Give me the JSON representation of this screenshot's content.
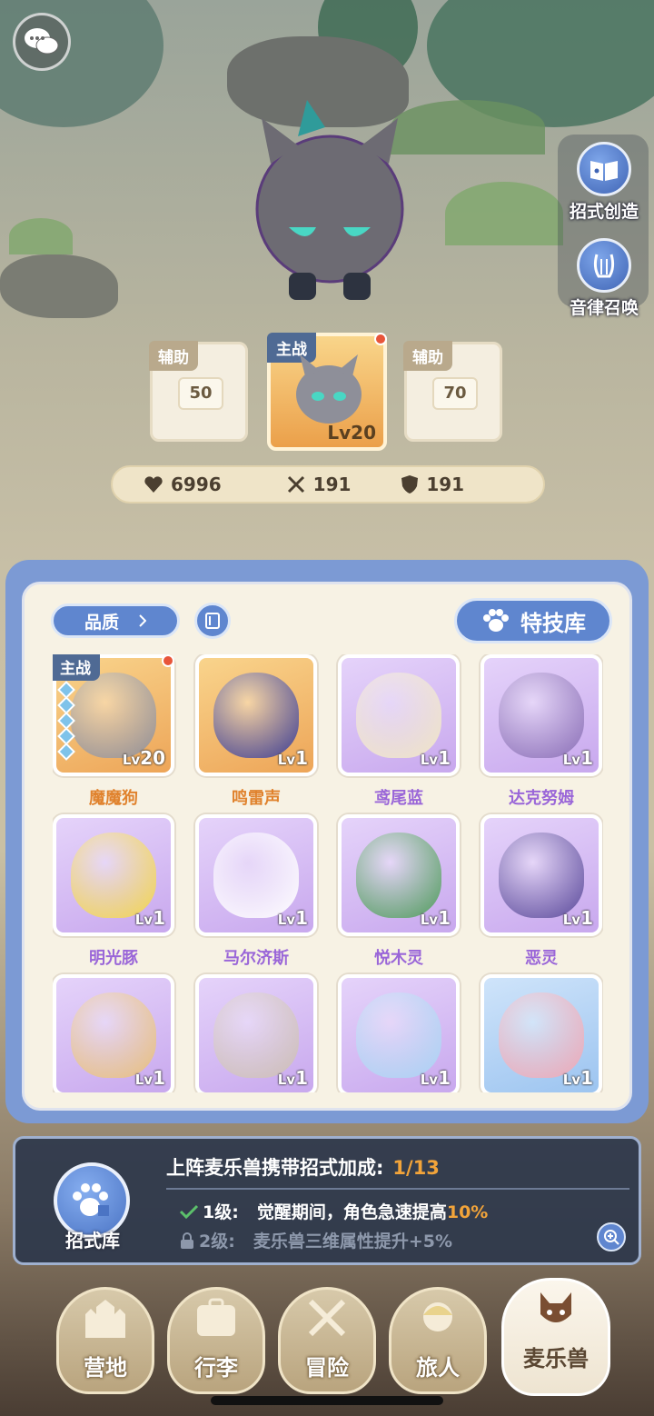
{
  "top_buttons": {
    "chat_icon": "chat-bubbles-icon",
    "move_create_label": "招式创造",
    "melody_summon_label": "音律召唤"
  },
  "team": {
    "left_slot": {
      "tag": "辅助",
      "level": "50"
    },
    "main_slot": {
      "tag": "主战",
      "level": "Lv20"
    },
    "right_slot": {
      "tag": "辅助",
      "level": "70"
    }
  },
  "stats": {
    "hp": "6996",
    "attack": "191",
    "defense": "191"
  },
  "panel": {
    "quality_label": "品质",
    "skill_library_label": "特技库",
    "monsters": [
      {
        "name": "魔魔狗",
        "level": "20",
        "rarity": "gold",
        "main": true,
        "tag": "主战",
        "color": "#8e8f99"
      },
      {
        "name": "鸣雷声",
        "level": "1",
        "rarity": "gold",
        "color": "#3c3f96"
      },
      {
        "name": "鸢尾蓝",
        "level": "1",
        "rarity": "purple",
        "color": "#f1e7c5"
      },
      {
        "name": "达克努姆",
        "level": "1",
        "rarity": "purple",
        "color": "#8a6fb6"
      },
      {
        "name": "明光豚",
        "level": "1",
        "rarity": "purple",
        "color": "#f3d64b"
      },
      {
        "name": "马尔济斯",
        "level": "1",
        "rarity": "purple",
        "color": "#ffffff"
      },
      {
        "name": "悦木灵",
        "level": "1",
        "rarity": "purple",
        "color": "#4f9d5a"
      },
      {
        "name": "恶灵",
        "level": "1",
        "rarity": "purple",
        "color": "#5a4a9a"
      },
      {
        "name": "",
        "level": "1",
        "rarity": "purple",
        "color": "#e8c07a"
      },
      {
        "name": "",
        "level": "1",
        "rarity": "purple",
        "color": "#cdbfb4"
      },
      {
        "name": "",
        "level": "1",
        "rarity": "purple",
        "color": "#a9d3f3"
      },
      {
        "name": "",
        "level": "1",
        "rarity": "blue",
        "color": "#f0a7b4"
      }
    ],
    "lv_prefix": "Lv"
  },
  "bonus": {
    "library_label": "招式库",
    "title": "上阵麦乐兽携带招式加成:",
    "count": "1/13",
    "rows": [
      {
        "level": "1级:",
        "text_before": "觉醒期间，角色急速提高",
        "highlight": "10%",
        "unlocked": true
      },
      {
        "level": "2级:",
        "text_before": "麦乐兽三维属性提升+5%",
        "highlight": "",
        "unlocked": false
      }
    ]
  },
  "nav": [
    {
      "label": "营地",
      "icon": "castle-icon"
    },
    {
      "label": "行李",
      "icon": "luggage-icon"
    },
    {
      "label": "冒险",
      "icon": "crossed-swords-icon"
    },
    {
      "label": "旅人",
      "icon": "traveler-icon"
    },
    {
      "label": "麦乐兽",
      "icon": "fox-icon",
      "active": true
    }
  ]
}
